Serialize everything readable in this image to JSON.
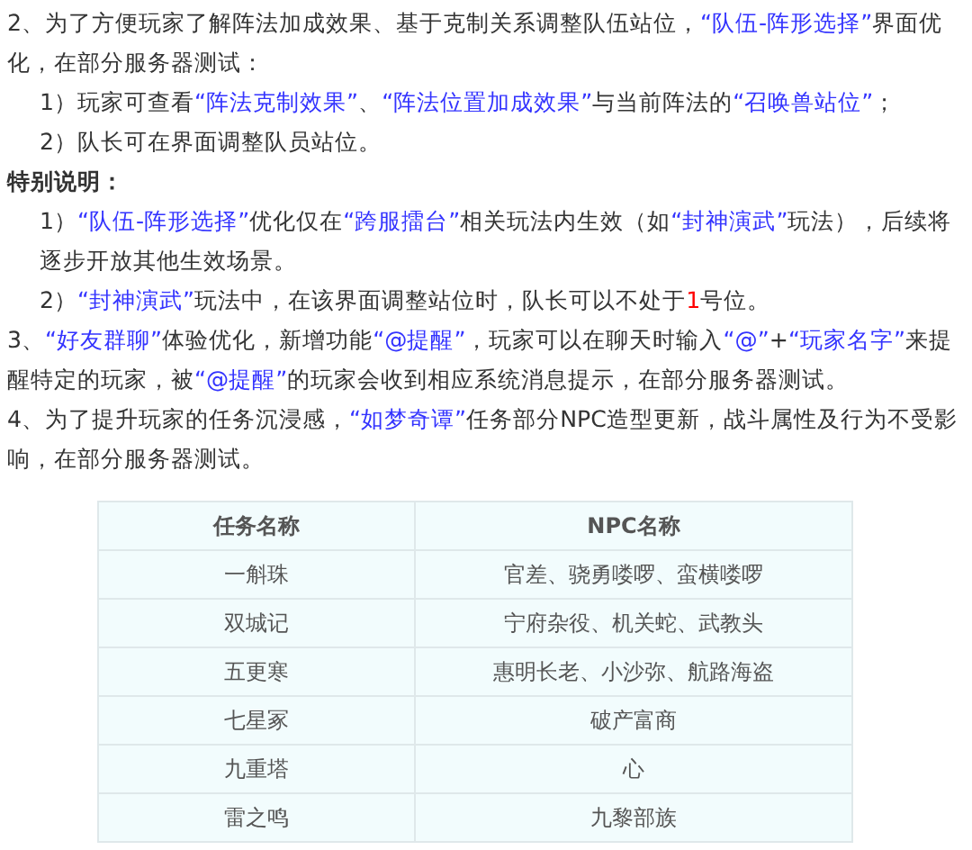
{
  "paragraphs": [
    {
      "kind": "plain",
      "segments": [
        {
          "kind": "plain",
          "text": "2、为了方便玩家了解阵法加成效果、基于克制关系调整队伍站位，"
        },
        {
          "kind": "blue",
          "text": "“队伍-阵形选择”"
        },
        {
          "kind": "plain",
          "text": "界面优化，在部分服务器测试："
        }
      ]
    },
    {
      "kind": "indent",
      "segments": [
        {
          "kind": "plain",
          "text": "1）玩家可查看"
        },
        {
          "kind": "blue",
          "text": "“阵法克制效果”"
        },
        {
          "kind": "plain",
          "text": "、"
        },
        {
          "kind": "blue",
          "text": "“阵法位置加成效果”"
        },
        {
          "kind": "plain",
          "text": "与当前阵法的"
        },
        {
          "kind": "blue",
          "text": "“召唤兽站位”"
        },
        {
          "kind": "plain",
          "text": "；"
        }
      ]
    },
    {
      "kind": "indent",
      "segments": [
        {
          "kind": "plain",
          "text": "2）队长可在界面调整队员站位。"
        }
      ]
    },
    {
      "kind": "heading",
      "segments": [
        {
          "kind": "plain",
          "text": "特别说明："
        }
      ]
    },
    {
      "kind": "indent",
      "segments": [
        {
          "kind": "plain",
          "text": "1）"
        },
        {
          "kind": "blue",
          "text": "“队伍-阵形选择”"
        },
        {
          "kind": "plain",
          "text": "优化仅在"
        },
        {
          "kind": "blue",
          "text": "“跨服擂台”"
        },
        {
          "kind": "plain",
          "text": "相关玩法内生效（如"
        },
        {
          "kind": "blue",
          "text": "“封神演武”"
        },
        {
          "kind": "plain",
          "text": "玩法），后续将逐步开放其他生效场景。"
        }
      ]
    },
    {
      "kind": "indent",
      "segments": [
        {
          "kind": "plain",
          "text": "2）"
        },
        {
          "kind": "blue",
          "text": "“封神演武”"
        },
        {
          "kind": "plain",
          "text": "玩法中，在该界面调整站位时，队长可以不处于"
        },
        {
          "kind": "red",
          "text": "1"
        },
        {
          "kind": "plain",
          "text": "号位。"
        }
      ]
    },
    {
      "kind": "plain",
      "segments": [
        {
          "kind": "plain",
          "text": "3、"
        },
        {
          "kind": "blue",
          "text": "“好友群聊”"
        },
        {
          "kind": "plain",
          "text": "体验优化，新增功能"
        },
        {
          "kind": "blue",
          "text": "“@提醒”"
        },
        {
          "kind": "plain",
          "text": "，玩家可以在聊天时输入"
        },
        {
          "kind": "blue",
          "text": "“@”"
        },
        {
          "kind": "plain",
          "text": "+"
        },
        {
          "kind": "blue",
          "text": "“玩家名字”"
        },
        {
          "kind": "plain",
          "text": "来提醒特定的玩家，被"
        },
        {
          "kind": "blue",
          "text": "“@提醒”"
        },
        {
          "kind": "plain",
          "text": "的玩家会收到相应系统消息提示，在部分服务器测试。"
        }
      ]
    },
    {
      "kind": "plain",
      "segments": [
        {
          "kind": "plain",
          "text": "4、为了提升玩家的任务沉浸感，"
        },
        {
          "kind": "blue",
          "text": "“如梦奇谭”"
        },
        {
          "kind": "plain",
          "text": "任务部分NPC造型更新，战斗属性及行为不受影响，在部分服务器测试。"
        }
      ]
    }
  ],
  "table": {
    "columns": [
      "任务名称",
      "NPC名称"
    ],
    "rows": [
      [
        "一斛珠",
        "官差、骁勇喽啰、蛮横喽啰"
      ],
      [
        "双城记",
        "宁府杂役、机关蛇、武教头"
      ],
      [
        "五更寒",
        "惠明长老、小沙弥、航路海盗"
      ],
      [
        "七星冢",
        "破产富商"
      ],
      [
        "九重塔",
        "心"
      ],
      [
        "雷之鸣",
        "九黎部族"
      ]
    ]
  }
}
